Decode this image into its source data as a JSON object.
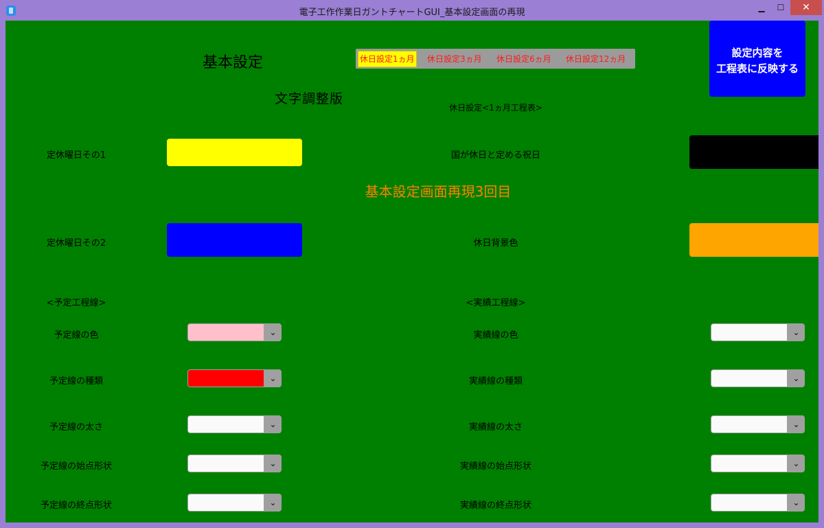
{
  "window": {
    "title": "電子工作作業日ガントチャートGUI_基本設定画面の再現",
    "minimize": "▁",
    "maximize": "☐",
    "close": "✕"
  },
  "header": {
    "title": "基本設定",
    "subtitle": "文字調整版",
    "tabs": [
      {
        "label": "休日設定1ヵ月",
        "active": true
      },
      {
        "label": "休日設定3ヵ月",
        "active": false
      },
      {
        "label": "休日設定6ヵ月",
        "active": false
      },
      {
        "label": "休日設定12ヵ月",
        "active": false
      }
    ],
    "section_caption": "休日設定<1ヵ月工程表>",
    "apply_button": {
      "line1": "設定内容を",
      "line2": "工程表に反映する"
    }
  },
  "holidays": {
    "regular1_label": "定休曜日その1",
    "regular1_color": "#ffff00",
    "regular2_label": "定休曜日その2",
    "regular2_color": "#0000ff",
    "national_label": "国が休日と定める祝日",
    "national_color": "#000000",
    "background_label": "休日背景色",
    "background_color": "#ffa500",
    "center_note": "基本設定画面再現3回目",
    "center_note_color": "#ff8000"
  },
  "planned": {
    "header": "<予定工程線>",
    "rows": [
      {
        "label": "予定線の色",
        "value_color": "#ffc0cb"
      },
      {
        "label": "予定線の種類",
        "value_color": "#ff0000"
      },
      {
        "label": "予定線の太さ",
        "value_color": "#fafafa"
      },
      {
        "label": "予定線の始点形状",
        "value_color": "#fafafa"
      },
      {
        "label": "予定線の終点形状",
        "value_color": "#fafafa"
      }
    ]
  },
  "actual": {
    "header": "<実績工程線>",
    "rows": [
      {
        "label": "実績線の色",
        "value_color": "#fafafa"
      },
      {
        "label": "実績線の種類",
        "value_color": "#fafafa"
      },
      {
        "label": "実績線の太さ",
        "value_color": "#fafafa"
      },
      {
        "label": "実績線の始点形状",
        "value_color": "#fafafa"
      },
      {
        "label": "実績線の終点形状",
        "value_color": "#fafafa"
      }
    ]
  },
  "icons": {
    "app": "app-icon",
    "dropdown": "chevron-down-icon",
    "dropdown_glyph": "⌄"
  }
}
